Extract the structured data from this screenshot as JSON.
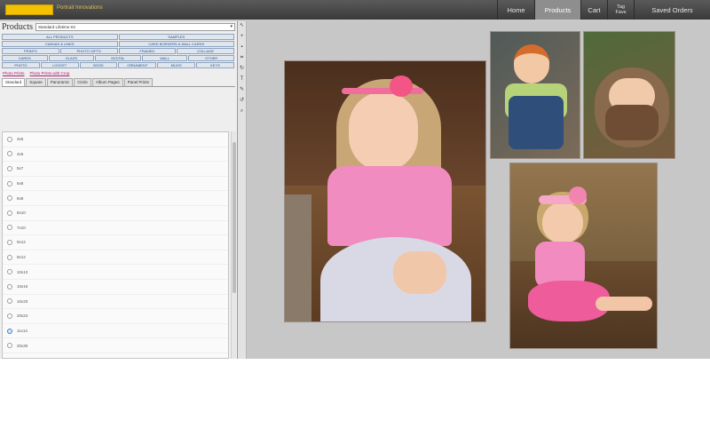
{
  "header": {
    "logo_subtitle": "Portrait Innovations",
    "nav": [
      {
        "label": "Home"
      },
      {
        "label": "Products",
        "active": true
      },
      {
        "label": "Cart"
      },
      {
        "label_line1": "Tag",
        "label_line2": "Favs"
      },
      {
        "label": "Saved Orders"
      }
    ]
  },
  "left_panel": {
    "title": "Products",
    "collection_select": "Standard Lifetime Kit",
    "categories": [
      [
        {
          "label": "ALL PRODUCTS"
        },
        {
          "label": "SAMPLES"
        }
      ],
      [
        {
          "label": "CANVAS & LINES"
        },
        {
          "label": "CARD BORDERS & WALL CARDS"
        }
      ],
      [
        {
          "label": "PRINTS"
        },
        {
          "label": "PHOTO GIFTS"
        },
        {
          "label": "FRAMED"
        },
        {
          "label": "COLLAGE"
        }
      ],
      [
        {
          "label": "CARDS"
        },
        {
          "label": "GLASS"
        },
        {
          "label": "DIGITAL"
        },
        {
          "label": "WALL"
        },
        {
          "label": "OTHER"
        }
      ],
      [
        {
          "label": "PHOTO"
        },
        {
          "label": "LOCKET"
        },
        {
          "label": "BOOK"
        },
        {
          "label": "ORNAMENT"
        },
        {
          "label": "MUGS"
        },
        {
          "label": "KEYS"
        }
      ]
    ],
    "links": [
      "Photo Prints",
      "Photo Prints with Crop"
    ],
    "size_tabs": [
      {
        "label": "Standard",
        "active": true
      },
      {
        "label": "Square"
      },
      {
        "label": "Panoramic"
      },
      {
        "label": "Circle"
      },
      {
        "label": "Album Pages"
      },
      {
        "label": "Panel Prints"
      }
    ],
    "sizes": [
      {
        "label": "3x5",
        "selected": false
      },
      {
        "label": "4x6",
        "selected": false
      },
      {
        "label": "5x7",
        "selected": false
      },
      {
        "label": "6x8",
        "selected": false
      },
      {
        "label": "8x8",
        "selected": false
      },
      {
        "label": "8x10",
        "selected": false
      },
      {
        "label": "7x10",
        "selected": false
      },
      {
        "label": "9x12",
        "selected": false
      },
      {
        "label": "8x12",
        "selected": false
      },
      {
        "label": "10x13",
        "selected": false
      },
      {
        "label": "10x15",
        "selected": false
      },
      {
        "label": "10x20",
        "selected": false
      },
      {
        "label": "20x24",
        "selected": false
      },
      {
        "label": "11x14",
        "selected": true
      },
      {
        "label": "20x30",
        "selected": false
      },
      {
        "label": "16x20",
        "selected": false
      }
    ]
  },
  "toolbar": {
    "icons": [
      "cursor-icon",
      "plus-icon",
      "trash-icon",
      "crop-icon",
      "rotate-icon",
      "text-icon",
      "magic-wand-icon",
      "rotate-ccw-icon",
      "zoom-icon"
    ]
  },
  "canvas": {
    "photos": [
      {
        "name": "girl-headband-portrait"
      },
      {
        "name": "boy-overalls-portrait"
      },
      {
        "name": "baby-nest-portrait"
      },
      {
        "name": "toddler-sitting-portrait"
      }
    ]
  }
}
